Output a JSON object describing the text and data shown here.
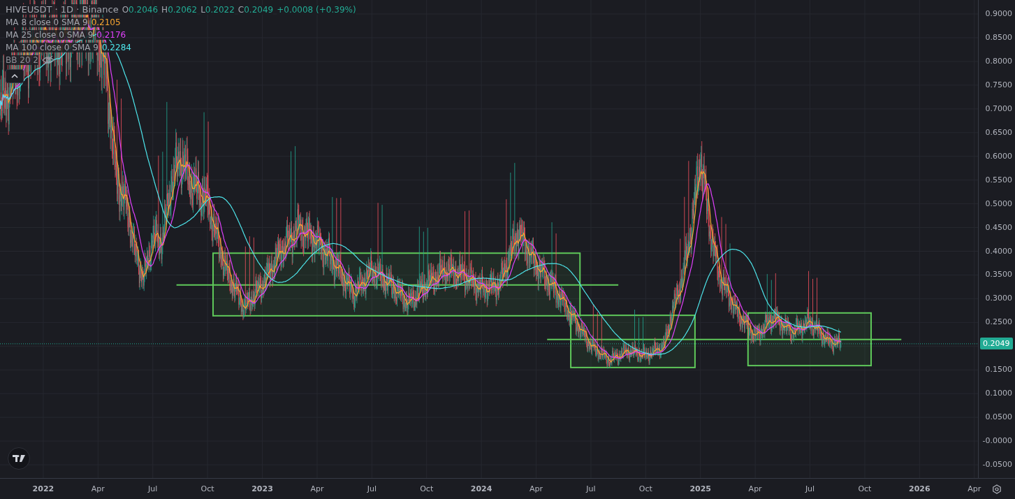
{
  "legend": {
    "symbol": "HIVEUSDT · 1D · Binance",
    "ohlc": [
      {
        "label": "O",
        "value": "0.2046"
      },
      {
        "label": "H",
        "value": "0.2062"
      },
      {
        "label": "L",
        "value": "0.2022"
      },
      {
        "label": "C",
        "value": "0.2049"
      }
    ],
    "change": "+0.0008 (+0.39%)"
  },
  "indicators": [
    {
      "name": "MA 8 close 0 SMA 9",
      "value": "0.2105",
      "color": "#f7a531"
    },
    {
      "name": "MA 25 close 0 SMA 9",
      "value": "0.2176",
      "color": "#e040fb"
    },
    {
      "name": "MA 100 close 0 SMA 9",
      "value": "0.2284",
      "color": "#4ee6ec"
    }
  ],
  "bollinger": {
    "name": "BB 20 2",
    "visible": false
  },
  "current_price": "0.2049",
  "price_axis": [
    "0.9000",
    "0.8500",
    "0.8000",
    "0.7500",
    "0.7000",
    "0.6500",
    "0.6000",
    "0.5500",
    "0.5000",
    "0.4500",
    "0.4000",
    "0.3500",
    "0.3000",
    "0.2500",
    "0.1500",
    "0.1000",
    "0.0500",
    "-0.0000",
    "-0.0500"
  ],
  "time_axis": [
    {
      "label": "2022",
      "kind": "year"
    },
    {
      "label": "Apr",
      "kind": "month"
    },
    {
      "label": "Jul",
      "kind": "month"
    },
    {
      "label": "Oct",
      "kind": "month"
    },
    {
      "label": "2023",
      "kind": "year"
    },
    {
      "label": "Apr",
      "kind": "month"
    },
    {
      "label": "Jul",
      "kind": "month"
    },
    {
      "label": "Oct",
      "kind": "month"
    },
    {
      "label": "2024",
      "kind": "year"
    },
    {
      "label": "Apr",
      "kind": "month"
    },
    {
      "label": "Jul",
      "kind": "month"
    },
    {
      "label": "Oct",
      "kind": "month"
    },
    {
      "label": "2025",
      "kind": "year"
    },
    {
      "label": "Apr",
      "kind": "month"
    },
    {
      "label": "Jul",
      "kind": "month"
    },
    {
      "label": "Oct",
      "kind": "month"
    },
    {
      "label": "2026",
      "kind": "year"
    },
    {
      "label": "Apr",
      "kind": "month"
    }
  ]
}
